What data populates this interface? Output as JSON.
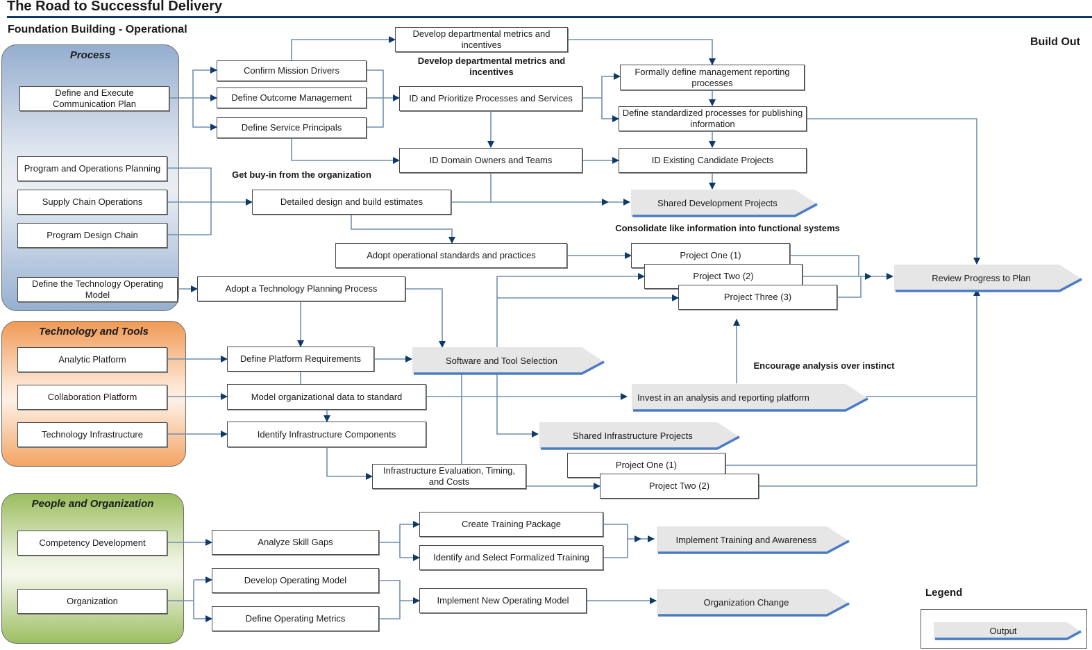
{
  "title": "The Road to Successful Delivery",
  "subtitle": "Foundation Building - Operational",
  "build_out": "Build Out",
  "panels": {
    "process": {
      "title": "Process",
      "items": [
        "Define and Execute Communication Plan",
        "Program and Operations Planning",
        "Supply Chain Operations",
        "Program Design Chain",
        "Define the Technology Operating Model"
      ]
    },
    "tech": {
      "title": "Technology and Tools",
      "items": [
        "Analytic Platform",
        "Collaboration Platform",
        "Technology Infrastructure"
      ]
    },
    "people": {
      "title": "People and Organization",
      "items": [
        "Competency Development",
        "Organization"
      ]
    }
  },
  "steps": {
    "confirm_mission": "Confirm Mission Drivers",
    "define_outcome": "Define Outcome Management",
    "define_service": "Define Service Principals",
    "dev_metrics": "Develop departmental metrics and incentives",
    "id_prioritize": "ID and Prioritize Processes and Services",
    "formally_define": "Formally define management reporting processes",
    "define_standardized": "Define standardized processes for publishing information",
    "id_domain": "ID Domain Owners and Teams",
    "id_existing": "ID Existing Candidate Projects",
    "detailed_design": "Detailed design and build estimates",
    "adopt_standards": "Adopt operational standards and practices",
    "project_one_a": "Project One (1)",
    "project_two_a": "Project Two (2)",
    "project_three_a": "Project Three (3)",
    "adopt_tech_planning": "Adopt a Technology Planning Process",
    "define_platform": "Define Platform Requirements",
    "model_data": "Model organizational data to standard",
    "identify_infra": "Identify Infrastructure Components",
    "infra_eval": "Infrastructure Evaluation, Timing, and Costs",
    "project_one_b": "Project One (1)",
    "project_two_b": "Project Two (2)",
    "analyze_skill": "Analyze Skill Gaps",
    "create_training": "Create Training Package",
    "identify_training": "Identify and Select Formalized Training",
    "develop_op_model": "Develop Operating Model",
    "define_op_metrics": "Define Operating Metrics",
    "implement_op_model": "Implement New Operating Model"
  },
  "outputs": {
    "shared_dev": "Shared Development Projects",
    "review_progress": "Review Progress to Plan",
    "software_tool": "Software and Tool Selection",
    "invest_analysis": "Invest in an analysis and reporting platform",
    "shared_infra": "Shared Infrastructure Projects",
    "implement_training": "Implement Training and Awareness",
    "org_change": "Organization Change"
  },
  "annotations": {
    "dev_metrics_note": "Develop departmental metrics and incentives",
    "buy_in": "Get buy-in from the organization",
    "consolidate": "Consolidate like information into functional systems",
    "encourage": "Encourage analysis over instinct"
  },
  "legend": {
    "title": "Legend",
    "output_label": "Output"
  },
  "colors": {
    "title_rule": "#0e3a6b",
    "connector": "#0e3a6b",
    "output_fill": "#e6e6e6",
    "output_accent": "#4a7bc4",
    "process_panel": "#95aed0",
    "tech_panel": "#f09a56",
    "people_panel": "#9bbd5f"
  }
}
